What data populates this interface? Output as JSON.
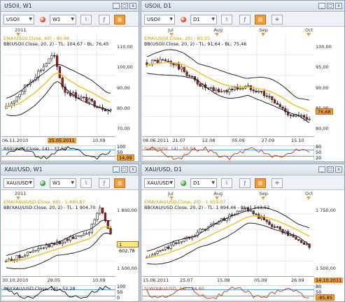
{
  "colors": {
    "up": "#ffffff",
    "down": "#b01818",
    "ema": "#f0c020",
    "bb": "#111111",
    "accent": "#f29c38",
    "rsi": "#b83a12",
    "rsiband": "#2a7ad4"
  },
  "panels": [
    {
      "title": "USOil, W1",
      "symbol": "USOil",
      "timeframe": "W1",
      "status_color": "#e04020",
      "top_dates": [
        "2011"
      ],
      "bb_label": "BB(USOil.Close, 20, 2) - TL: 104,67 - BL: 76,45",
      "ema_label": "EMA(USOil.Close, 60) - 90,98",
      "y_ticks": [
        "110,00",
        "100,00",
        "90,00",
        "80,00",
        "70,00"
      ],
      "x_dates": [
        "06.11.2010",
        "25.05.2011",
        "10.09"
      ],
      "x_highlight": "25.05.2011",
      "price_badge": "",
      "rsi_label": "RSI(USOil.Close, 14) - 37,50",
      "rsi_ticks": [
        "100",
        "50",
        "0"
      ],
      "rsi_value": "14,09"
    },
    {
      "title": "USOil, D1",
      "symbol": "USOil",
      "timeframe": "D1",
      "status_color": "#e04020",
      "top_dates": [
        "Jul",
        "Aug",
        "Sep",
        "Oct"
      ],
      "bb_label": "BB(USOil.Close, 20, 2) - TL: 91,64 - BL: 75,46",
      "ema_label": "EMA(USOil.Close, 20) - 83,55",
      "y_ticks": [
        "100,00",
        "95,00",
        "90,00",
        "85,00",
        "80,00"
      ],
      "x_dates": [
        "08.06.2011",
        "21.07",
        "12.08",
        "05.09",
        "27.09",
        "15.10"
      ],
      "x_highlight": "",
      "price_badge": "76,68",
      "rsi_label": "SLW(USOil, 14) - 55,53",
      "rsi_ticks": [
        "80",
        "50",
        "20"
      ],
      "rsi_value": ""
    },
    {
      "title": "XAU/USD, W1",
      "symbol": "XAU/USD",
      "timeframe": "W1",
      "status_color": "#30a030",
      "top_dates": [
        "2011"
      ],
      "bb_label": "BB(XAU/USD.Close, 20, 2) - TL: 1 904,70",
      "ema_label": "EMA(XAU/USD.Close, 60) - 1 480,87",
      "y_ticks": [
        "1 800,00",
        "1 500,00"
      ],
      "x_dates": [
        "30.10.2010",
        "28.05",
        "10.09"
      ],
      "x_highlight": "",
      "price_badge": "1 602,78",
      "rsi_label": "RSI(XAU/USD.Close, 14) - 52,28",
      "rsi_ticks": [
        "100",
        "50",
        "0"
      ],
      "rsi_value": ""
    },
    {
      "title": "XAU/USD, D1",
      "symbol": "XAU/USD",
      "timeframe": "D1",
      "status_color": "#30a030",
      "top_dates": [
        "Jul",
        "Aug",
        "Sep",
        "Oct"
      ],
      "bb_label": "BB(XAU/USD.Close, 20, 2) - TL: 1 894,46 - BL: 1 543,52",
      "ema_label": "EMA(XAU/USD.Close, 20) - 1 659,07",
      "y_ticks": [
        "1 750,00",
        "1 500,00"
      ],
      "x_dates": [
        "15.06.2011",
        "25.07",
        "15.08",
        "05.09",
        "26.09"
      ],
      "x_highlight": "14.10.2011",
      "price_badge": "",
      "rsi_label": "SLW(XAU/USD, 14) - 44,60",
      "rsi_ticks": [
        "80",
        "50",
        "20"
      ],
      "rsi_value": "-85,85"
    }
  ]
}
